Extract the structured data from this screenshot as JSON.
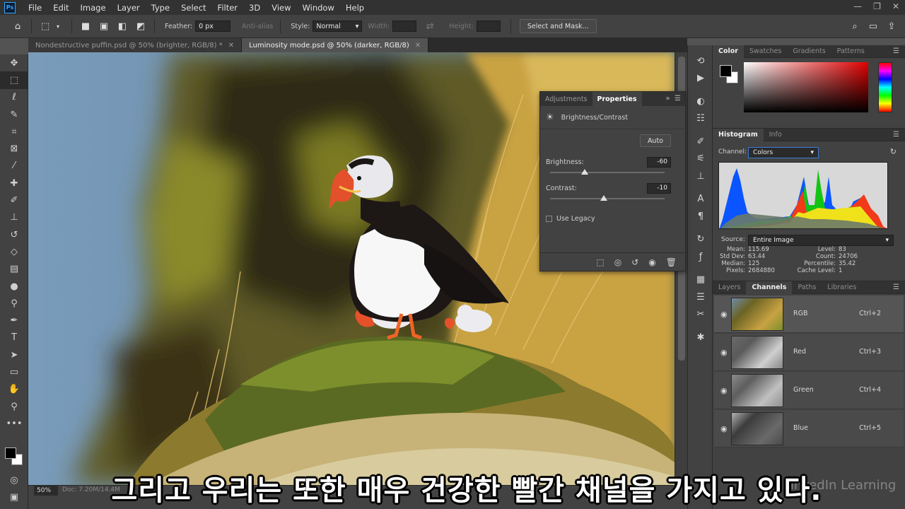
{
  "app": {
    "logo": "Ps"
  },
  "menu": [
    "File",
    "Edit",
    "Image",
    "Layer",
    "Type",
    "Select",
    "Filter",
    "3D",
    "View",
    "Window",
    "Help"
  ],
  "window_controls": {
    "minimize": "—",
    "restore": "❐",
    "close": "✕"
  },
  "options": {
    "feather_label": "Feather:",
    "feather_value": "0 px",
    "antialias_label": "Anti-alias",
    "style_label": "Style:",
    "style_value": "Normal",
    "width_label": "Width:",
    "height_label": "Height:",
    "select_mask_label": "Select and Mask..."
  },
  "tabs": [
    {
      "label": "Nondestructive puffin.psd @ 50% (brighter, RGB/8) *",
      "close": "✕"
    },
    {
      "label": "Luminosity mode.psd @ 50% (darker, RGB/8)",
      "close": "✕"
    }
  ],
  "status": {
    "zoom": "50%",
    "docinfo": "Doc: 7.20M/14.4M"
  },
  "subtitle": "그리고 우리는 또한 매우 건강한 빨간 채널을 가지고 있다.",
  "watermark": "LinkedIn Learning",
  "properties": {
    "tab_adjustments": "Adjustments",
    "tab_properties": "Properties",
    "layer_type": "Brightness/Contrast",
    "auto_label": "Auto",
    "brightness_label": "Brightness:",
    "brightness_value": "-60",
    "brightness_number": -60,
    "contrast_label": "Contrast:",
    "contrast_value": "-10",
    "contrast_number": -10,
    "slider_range": [
      -150,
      150
    ],
    "legacy_label": "Use Legacy"
  },
  "color_panel": {
    "tabs": [
      "Color",
      "Swatches",
      "Gradients",
      "Patterns"
    ],
    "fg": "#000000",
    "bg": "#ffffff"
  },
  "histogram": {
    "tabs": [
      "Histogram",
      "Info"
    ],
    "channel_label": "Channel:",
    "channel_value": "Colors",
    "source_label": "Source:",
    "source_value": "Entire Image",
    "stats_left": [
      {
        "k": "Mean:",
        "v": "115.69"
      },
      {
        "k": "Std Dev:",
        "v": "63.44"
      },
      {
        "k": "Median:",
        "v": "125"
      },
      {
        "k": "Pixels:",
        "v": "2684880"
      }
    ],
    "stats_right": [
      {
        "k": "Level:",
        "v": "83"
      },
      {
        "k": "Count:",
        "v": "24706"
      },
      {
        "k": "Percentile:",
        "v": "35.42"
      },
      {
        "k": "Cache Level:",
        "v": "1"
      }
    ]
  },
  "layers_panel": {
    "tabs": [
      "Layers",
      "Channels",
      "Paths",
      "Libraries"
    ],
    "channels": [
      {
        "name": "RGB",
        "shortcut": "Ctrl+2"
      },
      {
        "name": "Red",
        "shortcut": "Ctrl+3"
      },
      {
        "name": "Green",
        "shortcut": "Ctrl+4"
      },
      {
        "name": "Blue",
        "shortcut": "Ctrl+5"
      }
    ]
  }
}
